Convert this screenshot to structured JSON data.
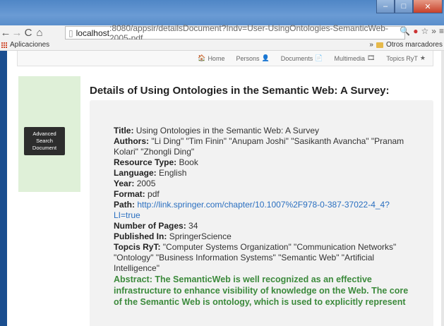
{
  "browser": {
    "url_host": "localhost",
    "url_rest": ":8080/appsir/detailsDocument?Indv=User-UsingOntologies-SemanticWeb-2005-pdf",
    "bookmark_apps_label": "Aplicaciones",
    "bookmark_more": "»",
    "bookmark_other": "Otros marcadores"
  },
  "nav": {
    "home": "Home",
    "persons": "Persons",
    "documents": "Documents",
    "multimedia": "Multimedia",
    "topics": "Topics RyT"
  },
  "sidebar": {
    "advanced_search": "Advanced Search Document"
  },
  "page": {
    "heading": "Details of Using Ontologies in the Semantic Web: A Survey:"
  },
  "details": {
    "title_label": "Title:",
    "title_value": "Using Ontologies in the Semantic Web: A Survey",
    "authors_label": "Authors:",
    "authors_value": "\"Li Ding\" \"Tim Finin\" \"Anupam Joshi\" \"Sasikanth Avancha\" \"Pranam Kolari\" \"Zhongli Ding\"",
    "type_label": "Resource Type:",
    "type_value": "Book",
    "language_label": "Language:",
    "language_value": "English",
    "year_label": "Year:",
    "year_value": "2005",
    "format_label": "Format:",
    "format_value": "pdf",
    "path_label": "Path:",
    "path_value": "http://link.springer.com/chapter/10.1007%2F978-0-387-37022-4_4?LI=true",
    "pages_label": "Number of Pages:",
    "pages_value": "34",
    "published_label": "Published In:",
    "published_value": "SpringerScience",
    "topics_label": "Topcis RyT:",
    "topics_value": "\"Computer Systems Organization\" \"Communication Networks\" \"Ontology\" \"Business Information Systems\" \"Semantic Web\" \"Artificial Intelligence\"",
    "abstract_label": "Abstract:",
    "abstract_value": "The SemanticWeb is well recognized as an effective infrastructure to enhance visibility of knowledge on the Web. The core of the Semantic Web is ontology, which is used to explicitly represent"
  }
}
